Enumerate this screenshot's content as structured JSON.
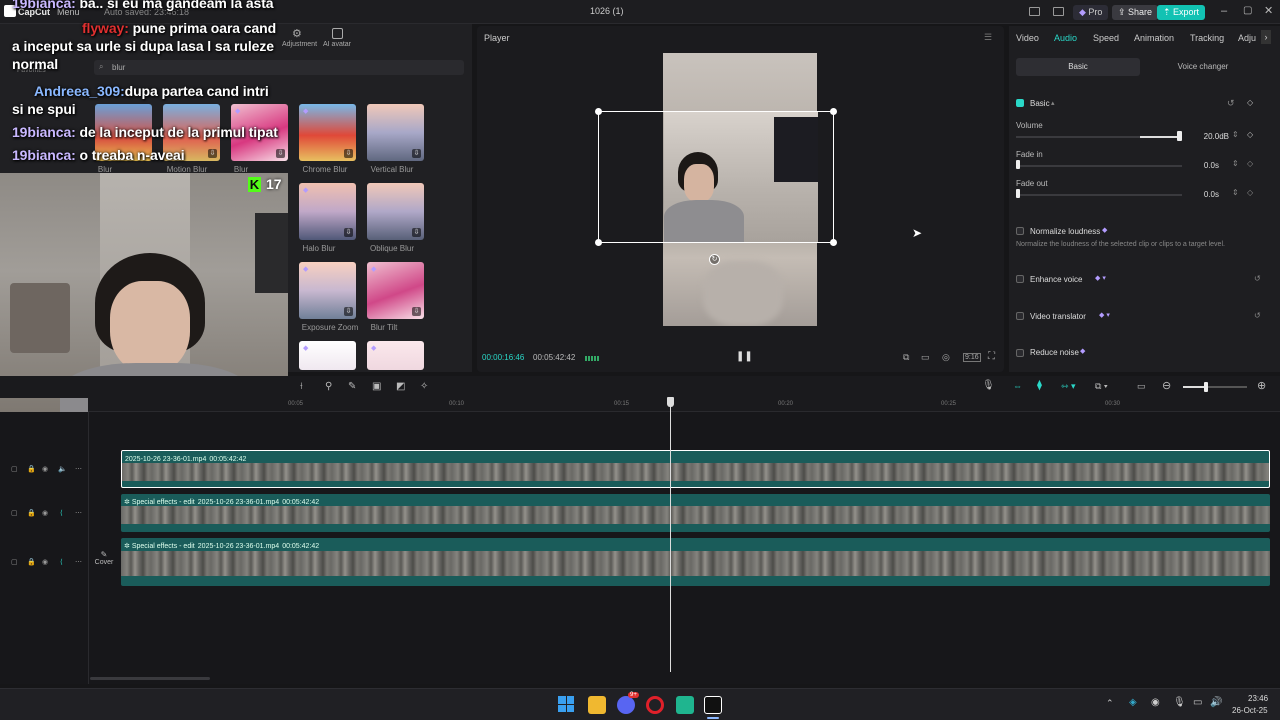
{
  "titlebar": {
    "app_name": "CapCut",
    "menu_label": "Menu",
    "autosave": "Auto saved: 23:46:18",
    "project_title": "1026 (1)",
    "pro_label": "Pro",
    "share_label": "Share",
    "export_label": "Export"
  },
  "left_panel": {
    "tabs": [
      "Adjustment",
      "AI avatar"
    ],
    "favorites_label": "Favorites",
    "search_value": "blur",
    "effects": [
      {
        "label": "Blur"
      },
      {
        "label": "Motion Blur"
      },
      {
        "label": "Blur"
      },
      {
        "label": "Chrome Blur"
      },
      {
        "label": "Vertical Blur"
      },
      {
        "label": "Halo Blur"
      },
      {
        "label": "Oblique Blur"
      },
      {
        "label": "Exposure Zoom"
      },
      {
        "label": "Blur Tilt"
      }
    ]
  },
  "chat_overlay": {
    "lines": [
      {
        "user": "19bianca:",
        "text": "ba.. si eu ma gandeam la asta"
      },
      {
        "user": "flyway:",
        "text": "pune prima oara cand"
      },
      {
        "user": "",
        "text": "a inceput sa urle si dupa lasa l sa ruleze"
      },
      {
        "user": "",
        "text": "normal"
      },
      {
        "user": "Andreea_309:",
        "text": "dupa partea cand intri"
      },
      {
        "user": "",
        "text": "si ne spui"
      },
      {
        "user": "19bianca:",
        "text": "de la inceput de la primul tipat"
      },
      {
        "user": "19bianca:",
        "text": "o treaba n-aveai"
      }
    ],
    "viewer_count": "17",
    "kick_logo": "K"
  },
  "player": {
    "title": "Player",
    "current_time": "00:00:16:46",
    "total_time": "00:05:42:42",
    "aspect_label": "9:16"
  },
  "right_panel": {
    "tabs": [
      "Video",
      "Audio",
      "Speed",
      "Animation",
      "Tracking",
      "Adju"
    ],
    "active_tab": "Audio",
    "subtabs": [
      "Basic",
      "Voice changer"
    ],
    "basic_label": "Basic",
    "volume_label": "Volume",
    "volume_value": "20.0dB",
    "fade_in_label": "Fade in",
    "fade_in_value": "0.0s",
    "fade_out_label": "Fade out",
    "fade_out_value": "0.0s",
    "normalize_label": "Normalize loudness",
    "normalize_desc": "Normalize the loudness of the selected clip or clips to a target level.",
    "enhance_label": "Enhance voice",
    "translator_label": "Video translator",
    "reduce_label": "Reduce noise"
  },
  "timeline": {
    "ruler_ticks": [
      "00:05",
      "00:10",
      "00:15",
      "00:20",
      "00:25",
      "00:30"
    ],
    "cover_label": "Cover",
    "tracks": [
      {
        "title": "2025-10-26 23-36-01.mp4",
        "duration": "00:05:42:42",
        "prefix": ""
      },
      {
        "title": "2025-10-26 23-36-01.mp4",
        "duration": "00:05:42:42",
        "prefix": "Special effects - edit"
      },
      {
        "title": "2025-10-26 23-36-01.mp4",
        "duration": "00:05:42:42",
        "prefix": "Special effects - edit"
      }
    ]
  },
  "taskbar": {
    "time": "23:46",
    "date": "26-Oct-25",
    "discord_badge": "9+"
  },
  "colors": {
    "accent": "#2ad8c8",
    "track": "#1a5c5a",
    "export": "#12c2b3",
    "chat_user": "#c9b8ff",
    "kick_green": "#53fc18"
  }
}
